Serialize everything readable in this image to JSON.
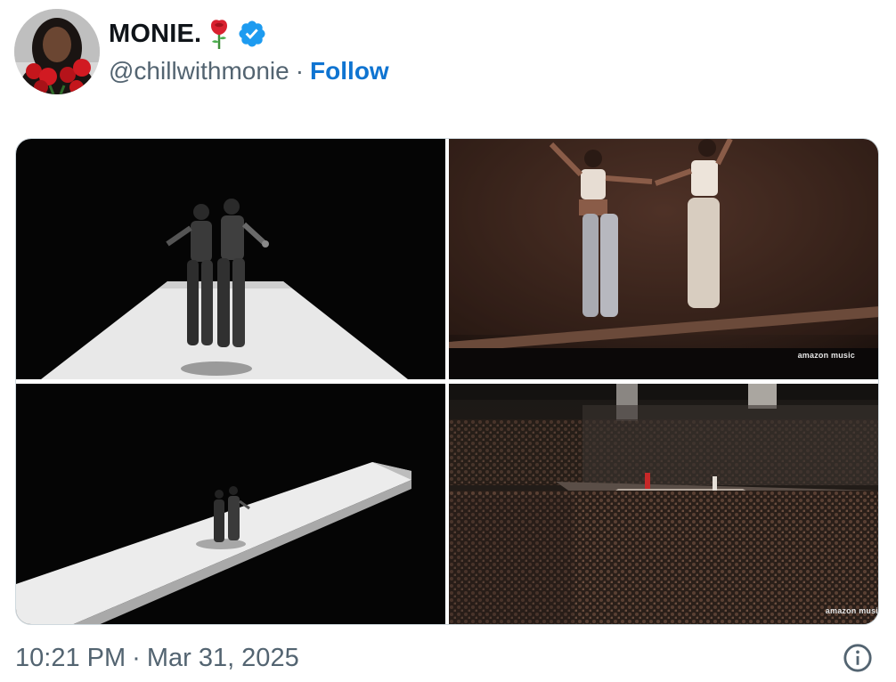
{
  "tweet": {
    "author": {
      "display_name": "MONIE.",
      "name_emoji": "🌹",
      "verified": true,
      "handle": "@chillwithmonie",
      "separator": "·",
      "follow_label": "Follow"
    },
    "media": [
      {
        "kind": "photo",
        "subject": "two dancers on white runway, black and white"
      },
      {
        "kind": "photo",
        "subject": "two performers holding hands on stage",
        "watermark": "amazon music"
      },
      {
        "kind": "photo",
        "subject": "two dancers on long white runway from above"
      },
      {
        "kind": "photo",
        "subject": "concert arena crowd with stage",
        "watermark": "amazon musi"
      }
    ],
    "time": "10:21 PM",
    "time_separator": "·",
    "date": "Mar 31, 2025"
  },
  "colors": {
    "link_blue": "#0f74d1",
    "verified_blue": "#1d9bf0",
    "secondary_text": "#536471"
  },
  "icons": {
    "verified": "verified-badge-icon",
    "info": "info-circle-icon",
    "rose": "rose-emoji"
  }
}
